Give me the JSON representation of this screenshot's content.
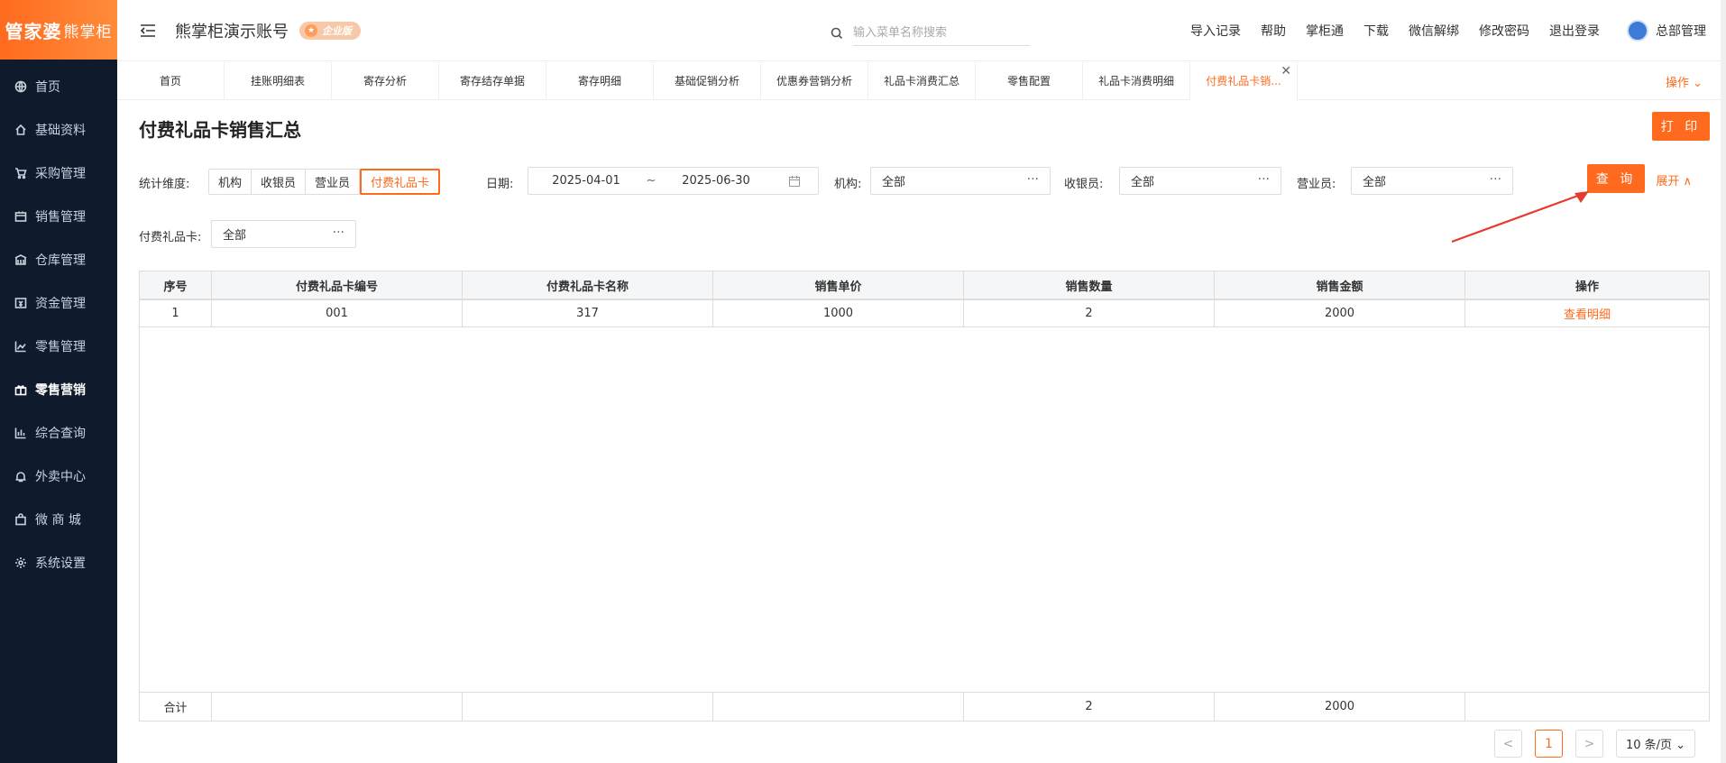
{
  "logo": {
    "text": "管家婆",
    "sub": "熊掌柜"
  },
  "sidebar": {
    "items": [
      {
        "label": "首页",
        "icon": "globe-icon"
      },
      {
        "label": "基础资料",
        "icon": "home-icon"
      },
      {
        "label": "采购管理",
        "icon": "cart-icon"
      },
      {
        "label": "销售管理",
        "icon": "sales-icon"
      },
      {
        "label": "仓库管理",
        "icon": "warehouse-icon"
      },
      {
        "label": "资金管理",
        "icon": "money-icon"
      },
      {
        "label": "零售管理",
        "icon": "retail-chart-icon"
      },
      {
        "label": "零售营销",
        "icon": "gift-icon"
      },
      {
        "label": "综合查询",
        "icon": "bar-chart-icon"
      },
      {
        "label": "外卖中心",
        "icon": "alarm-icon"
      },
      {
        "label": "微 商 城",
        "icon": "bag-icon"
      },
      {
        "label": "系统设置",
        "icon": "gear-icon"
      }
    ],
    "active": 7
  },
  "header": {
    "account": "熊掌柜演示账号",
    "badge": "企业版",
    "search_placeholder": "输入菜单名称搜索",
    "links": [
      "导入记录",
      "帮助",
      "掌柜通",
      "下载",
      "微信解绑",
      "修改密码",
      "退出登录"
    ],
    "user": "总部管理"
  },
  "tabs": [
    "首页",
    "挂账明细表",
    "寄存分析",
    "寄存结存单据",
    "寄存明细",
    "基础促销分析",
    "优惠券营销分析",
    "礼品卡消费汇总",
    "零售配置",
    "礼品卡消费明细",
    "付费礼品卡销..."
  ],
  "tabs_op": "操作 ⌄",
  "page": {
    "title": "付费礼品卡销售汇总",
    "print": "打 印",
    "filters": {
      "dim_label": "统计维度:",
      "dims": [
        "机构",
        "收银员",
        "营业员",
        "付费礼品卡"
      ],
      "dim_active": 3,
      "date_label": "日期:",
      "date_start": "2025-04-01",
      "date_sep": "~",
      "date_end": "2025-06-30",
      "org_label": "机构:",
      "org_value": "全部",
      "cashier_label": "收银员:",
      "cashier_value": "全部",
      "clerk_label": "营业员:",
      "clerk_value": "全部",
      "card_label": "付费礼品卡:",
      "card_value": "全部",
      "query": "查 询",
      "expand": "展开 ∧"
    }
  },
  "table": {
    "columns": [
      "序号",
      "付费礼品卡编号",
      "付费礼品卡名称",
      "销售单价",
      "销售数量",
      "销售金额",
      "操作"
    ],
    "rows": [
      [
        "1",
        "001",
        "317",
        "1000",
        "2",
        "2000",
        "查看明细"
      ]
    ],
    "footer": [
      "合计",
      "",
      "",
      "",
      "2",
      "2000",
      ""
    ]
  },
  "pager": {
    "prev": "<",
    "page": "1",
    "next": ">",
    "size": "10 条/页 ⌄"
  },
  "colors": {
    "accent": "#ff6a1e",
    "sidebar_bg": "#0f1b2d",
    "annotation_arrow": "#e8392f"
  }
}
